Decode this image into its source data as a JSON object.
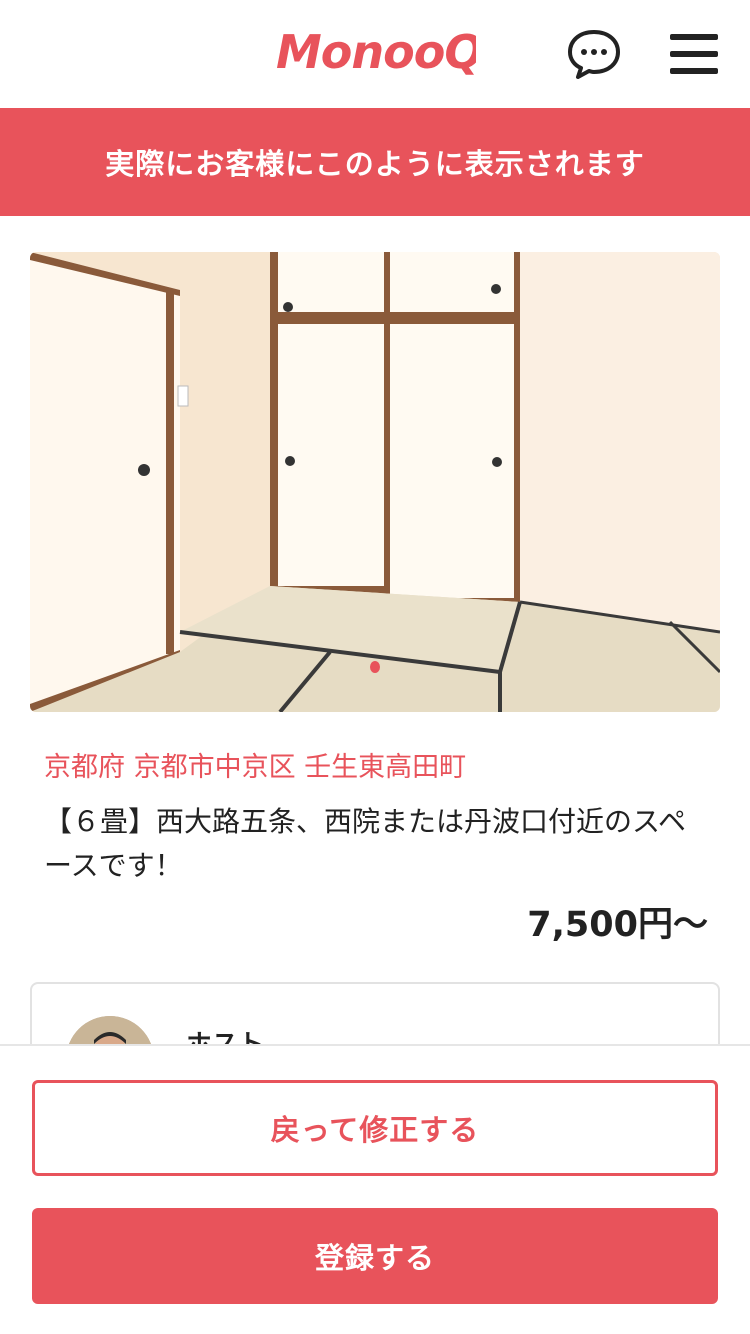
{
  "header": {
    "logo_text": "MonooQ",
    "brand_color": "#e8535b",
    "chat_icon": "chat-bubble-icon",
    "menu_icon": "hamburger-menu-icon"
  },
  "banner": {
    "text": "実際にお客様にこのように表示されます"
  },
  "listing": {
    "photo_alt": "和室 6畳",
    "location": "京都府 京都市中京区 壬生東高田町",
    "title": "【６畳】西大路五条、西院または丹波口付近のスペースです！",
    "price": "7,500円〜"
  },
  "host": {
    "label": "ホスト"
  },
  "actions": {
    "back_label": "戻って修正する",
    "register_label": "登録する"
  }
}
